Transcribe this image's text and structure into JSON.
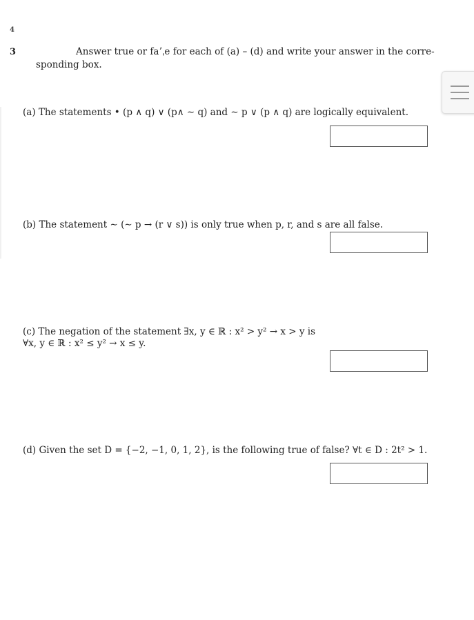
{
  "page": {
    "prev_question_number": "4",
    "question_number": "3",
    "instructions_line1": "Answer true or faʼˌe for each of (a) – (d) and write your answer in the corre-",
    "instructions_line2": "sponding box."
  },
  "parts": [
    {
      "label": "(a)",
      "text": "(a) The statements  •  (p ∧ q) ∨ (p∧ ∼ q)   and   ∼ p ∨ (p ∧ q)   are logically equivalent.",
      "answer": ""
    },
    {
      "label": "(b)",
      "text": "(b) The statement ∼ (∼ p → (r ∨ s)) is only true when p, r, and s are all false.",
      "answer": ""
    },
    {
      "label": "(c)",
      "text_line1": "(c) The negation of the statement   ∃x, y ∈ ℝ : x² > y² → x > y  is",
      "text_line2": "∀x, y ∈ ℝ : x² ≤ y² → x ≤ y.",
      "answer": ""
    },
    {
      "label": "(d)",
      "text": "(d) Given the set D = {−2, −1, 0, 1, 2}, is the following true of false?   ∀t ∈ D : 2t² > 1.",
      "answer": ""
    }
  ],
  "menu": {
    "icon": "hamburger-menu-icon"
  }
}
